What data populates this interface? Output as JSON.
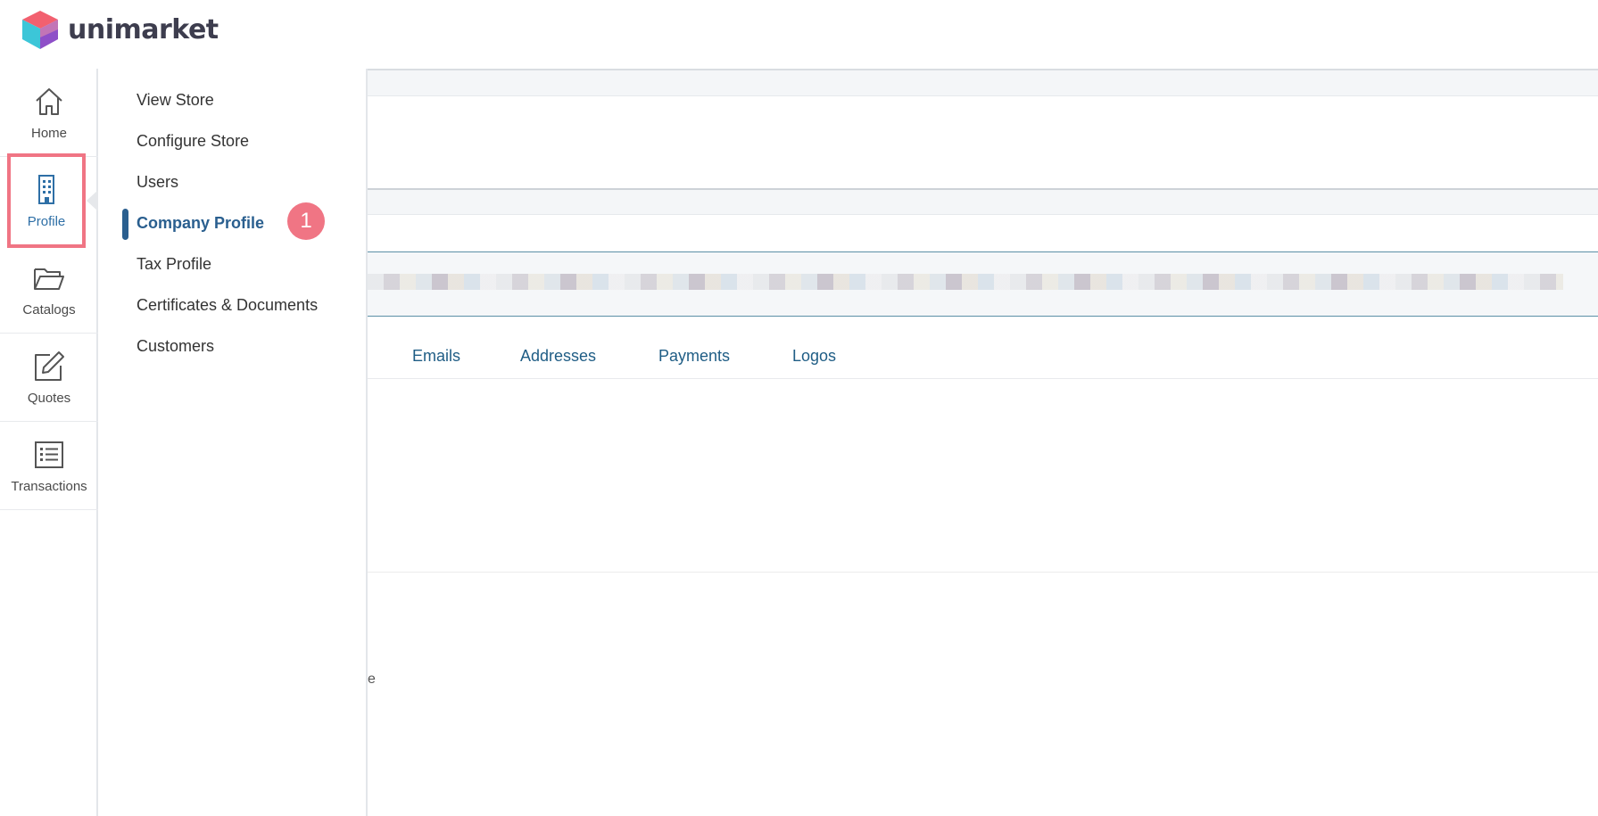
{
  "brand": {
    "name": "unimarket"
  },
  "rail": {
    "items": [
      {
        "label": "Home",
        "icon": "home-icon"
      },
      {
        "label": "Profile",
        "icon": "building-icon"
      },
      {
        "label": "Catalogs",
        "icon": "folder-icon"
      },
      {
        "label": "Quotes",
        "icon": "edit-icon"
      },
      {
        "label": "Transactions",
        "icon": "list-icon"
      }
    ]
  },
  "submenu": {
    "items": [
      {
        "label": "View Store"
      },
      {
        "label": "Configure Store"
      },
      {
        "label": "Users"
      },
      {
        "label": "Company Profile"
      },
      {
        "label": "Tax Profile"
      },
      {
        "label": "Certificates & Documents"
      },
      {
        "label": "Customers"
      }
    ],
    "active_index": 3,
    "step_badge": "1"
  },
  "tabs": [
    {
      "label": "Emails"
    },
    {
      "label": "Addresses"
    },
    {
      "label": "Payments"
    },
    {
      "label": "Logos"
    }
  ],
  "fragment_text": "e",
  "colors": {
    "accent": "#2a5f8f",
    "highlight": "#f07584",
    "tab_text": "#1f5d85"
  }
}
